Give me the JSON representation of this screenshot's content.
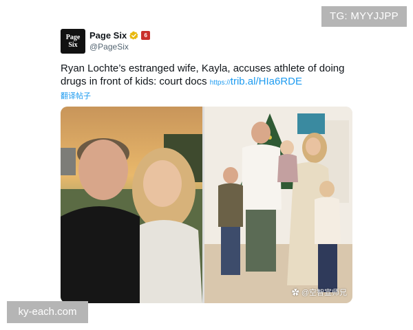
{
  "watermark_top": "TG: MYYJJPP",
  "watermark_bottom": "ky-each.com",
  "tweet": {
    "account_name": "Page Six",
    "account_handle": "@PageSix",
    "avatar_text_line1": "Page",
    "avatar_text_line2": "Six",
    "affiliate_badge_text": "6",
    "text_main": "Ryan Lochte’s estranged wife, Kayla, accuses athlete of doing drugs in front of kids: court docs",
    "link_prefix": "https://",
    "link_text": "trib.al/HIa6RDE",
    "translate_label": "翻译帖子",
    "photo_credit": "@空智宣师兄"
  },
  "colors": {
    "link": "#1d9bf0",
    "verified": "#e8b90f",
    "affiliate_badge": "#c9302c",
    "watermark_bg": "#b5b5b5"
  },
  "icons": {
    "verified": "verified-badge-icon",
    "affiliate": "affiliate-badge-icon",
    "credit": "paw-icon"
  }
}
